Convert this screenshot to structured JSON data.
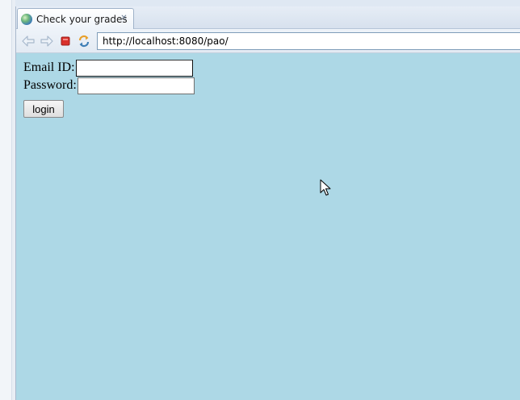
{
  "window": {
    "tab": {
      "title": "Check your grades",
      "icon": "globe-icon",
      "close_icon": "close-icon"
    },
    "navigation": {
      "back_icon": "back-arrow-icon",
      "forward_icon": "forward-arrow-icon",
      "stop_icon": "stop-icon",
      "refresh_icon": "refresh-icon",
      "url": "http://localhost:8080/pao/"
    }
  },
  "page": {
    "background_color": "#add8e6",
    "form": {
      "email_label": "Email ID:",
      "email_value": "",
      "password_label": "Password:",
      "password_value": "",
      "login_label": "login"
    }
  },
  "colors": {
    "stop": "#d9302b",
    "refresh": "#e8a02b",
    "nav_disabled": "#a7b8cc"
  }
}
